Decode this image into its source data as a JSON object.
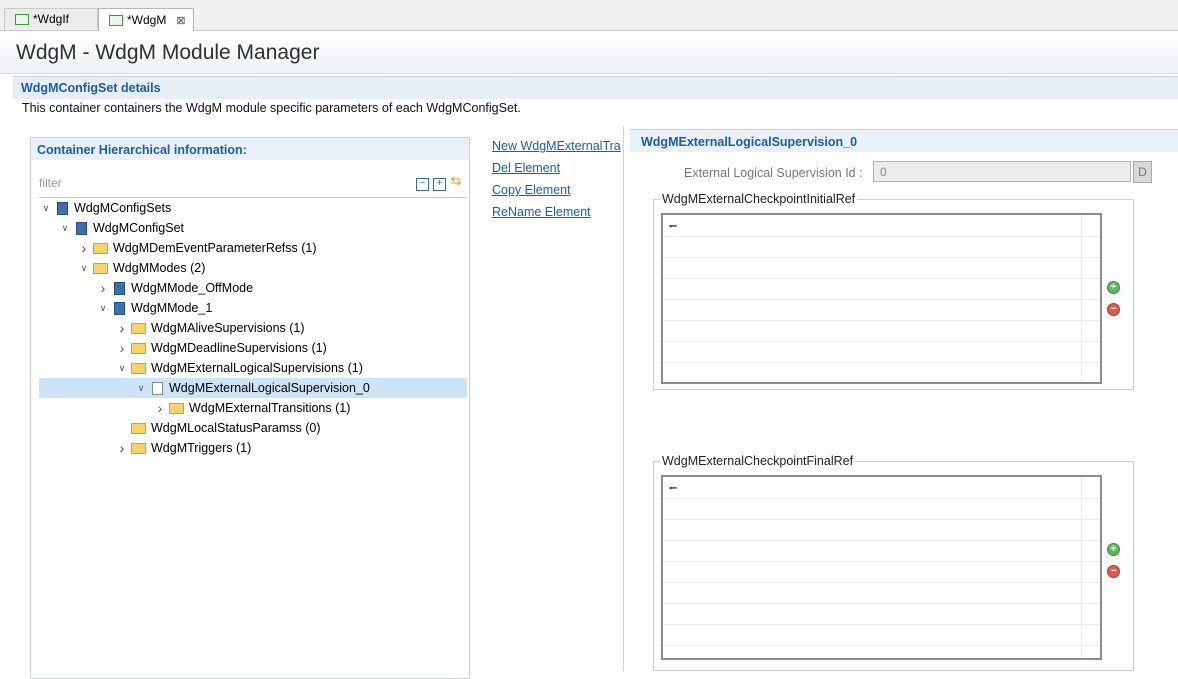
{
  "tabs": [
    {
      "label": "*WdgIf",
      "active": false
    },
    {
      "label": "*WdgM",
      "active": true,
      "close": "⊠"
    }
  ],
  "page_title": "WdgM - WdgM Module Manager",
  "section": {
    "title": "WdgMConfigSet details",
    "description": "This container containers the WdgM module specific parameters of each WdgMConfigSet."
  },
  "left_panel": {
    "title": "Container Hierarchical information:",
    "filter_placeholder": "filter",
    "tree": [
      {
        "label": "WdgMConfigSets",
        "icon": "file-blue",
        "level": 0,
        "expander": "expanded"
      },
      {
        "label": "WdgMConfigSet",
        "icon": "file-blue",
        "level": 1,
        "expander": "expanded"
      },
      {
        "label": "WdgMDemEventParameterRefss (1)",
        "icon": "folder",
        "level": 2,
        "expander": "collapsed"
      },
      {
        "label": "WdgMModes (2)",
        "icon": "folder",
        "level": 2,
        "expander": "expanded"
      },
      {
        "label": "WdgMMode_OffMode",
        "icon": "file-blue",
        "level": 3,
        "expander": "collapsed"
      },
      {
        "label": "WdgMMode_1",
        "icon": "file-blue",
        "level": 3,
        "expander": "expanded"
      },
      {
        "label": "WdgMAliveSupervisions (1)",
        "icon": "folder",
        "level": 4,
        "expander": "collapsed"
      },
      {
        "label": "WdgMDeadlineSupervisions (1)",
        "icon": "folder",
        "level": 4,
        "expander": "collapsed"
      },
      {
        "label": "WdgMExternalLogicalSupervisions (1)",
        "icon": "folder",
        "level": 4,
        "expander": "expanded"
      },
      {
        "label": "WdgMExternalLogicalSupervision_0",
        "icon": "doc",
        "level": 5,
        "expander": "expanded",
        "selected": true
      },
      {
        "label": "WdgMExternalTransitions (1)",
        "icon": "folder",
        "level": 6,
        "expander": "collapsed"
      },
      {
        "label": "WdgMLocalStatusParamss (0)",
        "icon": "folder",
        "level": 4,
        "expander": "none"
      },
      {
        "label": "WdgMTriggers (1)",
        "icon": "folder",
        "level": 4,
        "expander": "collapsed"
      }
    ]
  },
  "actions": {
    "new_element": "New WdgMExternalTra",
    "del_element": "Del Element",
    "copy_element": "Copy Element",
    "rename_element": "ReName Element"
  },
  "right_panel": {
    "title": "WdgMExternalLogicalSupervision_0",
    "field_label": "External Logical Supervision Id :",
    "field_value": "0",
    "field_button": "D",
    "groups": [
      {
        "label": "WdgMExternalCheckpointInitialRef",
        "marker": "▪━"
      },
      {
        "label": "WdgMExternalCheckpointFinalRef",
        "marker": "▪━"
      }
    ]
  },
  "colors": {
    "accent": "#1a5ea8",
    "selection": "#cde4f7",
    "add": "#5cb85c",
    "remove": "#e05a4a"
  }
}
